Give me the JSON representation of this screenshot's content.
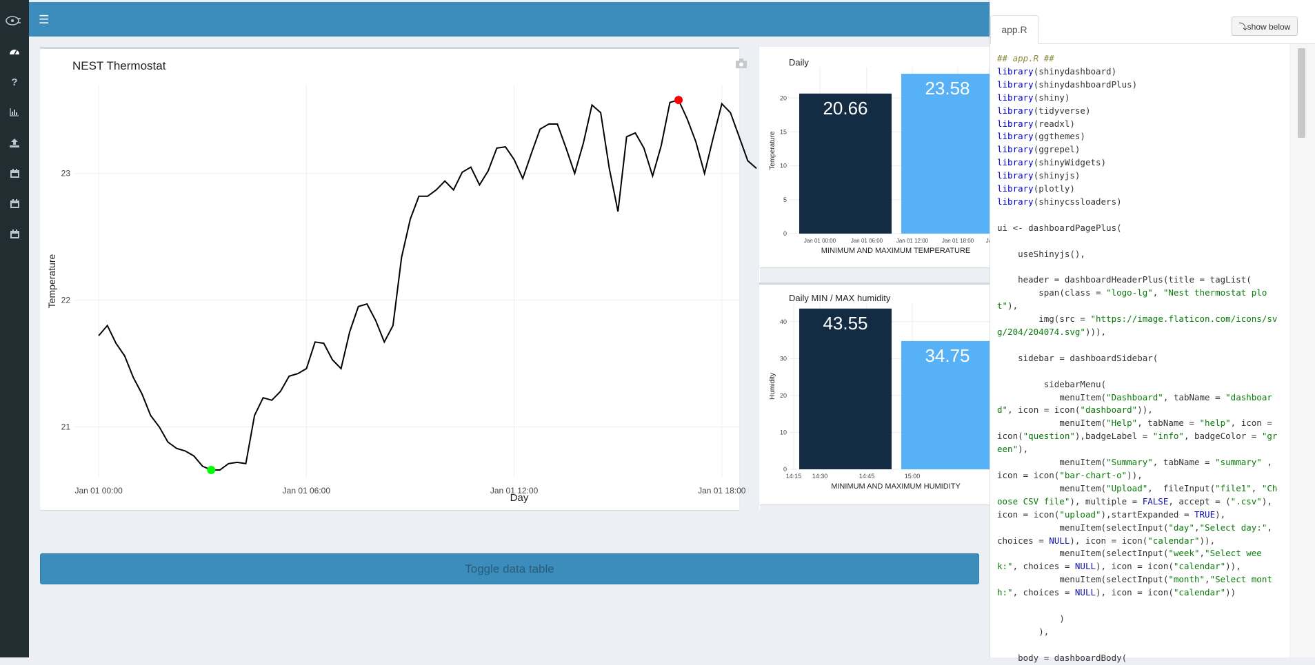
{
  "sidebar": {
    "items": [
      {
        "icon": "dashboard-icon"
      },
      {
        "icon": "question-icon"
      },
      {
        "icon": "bar-chart-icon"
      },
      {
        "icon": "upload-icon"
      },
      {
        "icon": "calendar-icon"
      },
      {
        "icon": "calendar-icon"
      },
      {
        "icon": "calendar-icon"
      }
    ]
  },
  "header": {
    "menu_icon": "hamburger-icon"
  },
  "main": {
    "toggle_label": "Toggle data table"
  },
  "code_panel": {
    "tab_label": "app.R",
    "show_below_label": "⤵show below"
  },
  "chart_data": [
    {
      "type": "line",
      "title": "NEST Thermostat",
      "xlabel": "Day",
      "ylabel": "Temperature",
      "x_ticks": [
        "Jan 01 00:00",
        "Jan 01 06:00",
        "Jan 01 12:00",
        "Jan 01 18:00"
      ],
      "y_ticks": [
        21,
        22,
        23
      ],
      "ylim": [
        20.6,
        23.7
      ],
      "xlim_hours": [
        -0.7,
        19.1
      ],
      "series": [
        {
          "color": "#000000",
          "x_hours": [
            0,
            0.25,
            0.5,
            0.75,
            1,
            1.25,
            1.5,
            1.75,
            2,
            2.25,
            2.5,
            2.75,
            3,
            3.25,
            3.5,
            3.75,
            4,
            4.25,
            4.5,
            4.75,
            5,
            5.25,
            5.5,
            5.75,
            6,
            6.25,
            6.5,
            6.75,
            7,
            7.25,
            7.5,
            7.75,
            8,
            8.25,
            8.5,
            8.75,
            9,
            9.25,
            9.5,
            9.75,
            10,
            10.25,
            10.5,
            10.75,
            11,
            11.25,
            11.5,
            11.75,
            12,
            12.25,
            12.5,
            12.75,
            13,
            13.25,
            13.5,
            13.75,
            14,
            14.25,
            14.5,
            14.75,
            15,
            15.25,
            15.5,
            15.75,
            16,
            16.25,
            16.5,
            16.75,
            17,
            17.25,
            17.5,
            17.75,
            18,
            18.25,
            18.5,
            18.75,
            19
          ],
          "y": [
            21.72,
            21.8,
            21.66,
            21.56,
            21.39,
            21.26,
            21.09,
            21,
            20.88,
            20.83,
            20.81,
            20.77,
            20.69,
            20.66,
            20.66,
            20.71,
            20.72,
            20.71,
            21.09,
            21.23,
            21.21,
            21.28,
            21.4,
            21.42,
            21.46,
            21.67,
            21.66,
            21.53,
            21.46,
            21.75,
            21.95,
            21.97,
            21.84,
            21.67,
            21.8,
            22.34,
            22.64,
            22.82,
            22.82,
            22.87,
            22.94,
            22.87,
            23.01,
            23.05,
            22.91,
            23.02,
            23.2,
            23.21,
            23.11,
            22.96,
            23.16,
            23.35,
            23.39,
            23.39,
            23.2,
            23,
            23.24,
            23.54,
            23.48,
            23.04,
            22.7,
            23.29,
            23.32,
            23.2,
            22.98,
            23.22,
            23.56,
            23.58,
            23.43,
            23.25,
            23,
            23.28,
            23.55,
            23.48,
            23.29,
            23.1,
            23.04
          ]
        }
      ],
      "annotations": [
        {
          "label": "min",
          "x_hours": 3.25,
          "y": 20.66,
          "color": "#00ff00"
        },
        {
          "label": "max",
          "x_hours": 16.75,
          "y": 23.58,
          "color": "#ff0000"
        }
      ]
    },
    {
      "type": "bar",
      "title": "Daily",
      "xlabel": "MINIMUM AND MAXIMUM TEMPERATURE",
      "ylabel": "Temperature",
      "x_ticks": [
        "Jan 01 00:00",
        "Jan 01 06:00",
        "Jan 01 12:00",
        "Jan 01 18:00",
        "Ja"
      ],
      "y_ticks": [
        0,
        5,
        10,
        15,
        20
      ],
      "ylim": [
        0,
        24.5
      ],
      "values": [
        20.66,
        23.58
      ],
      "labels": [
        "20.66",
        "23.58"
      ],
      "colors": [
        "#132b43",
        "#56b1f7"
      ]
    },
    {
      "type": "bar",
      "title": "Daily MIN / MAX humidity",
      "xlabel": "MINIMUM AND MAXIMUM HUMIDITY",
      "ylabel": "Humidity",
      "x_ticks": [
        "14:15",
        "14:30",
        "14:45",
        "15:00"
      ],
      "y_ticks": [
        0,
        10,
        20,
        30,
        40
      ],
      "ylim": [
        0,
        45
      ],
      "values": [
        43.55,
        34.75
      ],
      "labels": [
        "43.55",
        "34.75"
      ],
      "colors": [
        "#132b43",
        "#56b1f7"
      ]
    }
  ]
}
